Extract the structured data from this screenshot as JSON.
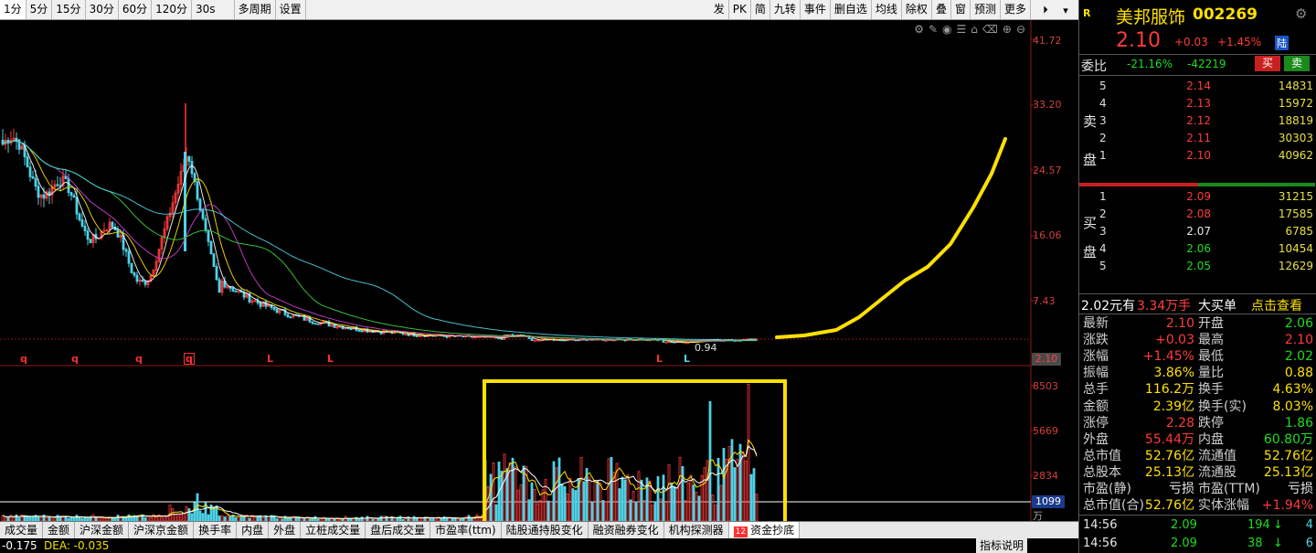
{
  "toolbar": {
    "periods": [
      "1分",
      "5分",
      "15分",
      "30分",
      "60分",
      "120分",
      "30s",
      "多周期",
      "设置"
    ],
    "actions": [
      "发",
      "PK",
      "简",
      "九转",
      "事件",
      "删自选",
      "均线",
      "除权",
      "叠",
      "窗",
      "预测",
      "更多"
    ],
    "icons": [
      "expand-icon",
      "chevron-down-icon"
    ]
  },
  "chart": {
    "price_ticks": [
      "41.72",
      "33.20",
      "24.57",
      "16.06",
      "7.43",
      "2.10"
    ],
    "volume_ticks": [
      "8503",
      "5669",
      "2834",
      "1099"
    ],
    "volume_unit": "万",
    "low_label": "0.94",
    "marks": [
      "q",
      "q",
      "q",
      "q",
      "L",
      "L",
      "L",
      "L"
    ],
    "tools": [
      "⚙",
      "✎",
      "◉",
      "☰",
      "⌂",
      "⌫",
      "⊕",
      "⊖"
    ]
  },
  "chart_data": {
    "type": "candlestick",
    "note_colors": {
      "up": "#ff3b3b",
      "down": "#4dd3e8",
      "ma": [
        "#ffffff",
        "#ffe000",
        "#d040d0",
        "#40d040",
        "#4dd3e8"
      ],
      "projection": "#ffe000",
      "highlight_box": "#ffe000"
    },
    "price_axis": [
      2.1,
      7.43,
      16.06,
      24.57,
      33.2,
      41.72
    ],
    "volume_axis": [
      1099,
      2834,
      5669,
      8503
    ],
    "current_price": 2.1,
    "period_low": 0.94
  },
  "bottom_tabs": [
    "成交量",
    "金额",
    "沪深金额",
    "沪深京金额",
    "换手率",
    "内盘",
    "外盘",
    "立桩成交量",
    "盘后成交量",
    "市盈率(ttm)",
    "陆股通持股变化",
    "融资融券变化",
    "机构探测器",
    "资金抄底"
  ],
  "bottom_tab_badge": "12",
  "status": {
    "s1": "-0.175",
    "s2": "DEA: -0.035",
    "help": "指标说明"
  },
  "panel": {
    "badge": "R",
    "name": "美邦服饰",
    "code": "002269",
    "price": "2.10",
    "change": "+0.03",
    "change_pct": "+1.45%",
    "tag": "陆",
    "weibi_label": "委比",
    "weibi_pct": "-21.16%",
    "weicha": "-42219",
    "buy_btn": "买",
    "sell_btn": "卖",
    "sell_label": "卖盘",
    "buy_label": "买盘",
    "asks": [
      {
        "lv": "5",
        "price": "2.14",
        "vol": "14831"
      },
      {
        "lv": "4",
        "price": "2.13",
        "vol": "15972"
      },
      {
        "lv": "3",
        "price": "2.12",
        "vol": "18819"
      },
      {
        "lv": "2",
        "price": "2.11",
        "vol": "30303"
      },
      {
        "lv": "1",
        "price": "2.10",
        "vol": "40962"
      }
    ],
    "bids": [
      {
        "lv": "1",
        "price": "2.09",
        "vol": "31215"
      },
      {
        "lv": "2",
        "price": "2.08",
        "vol": "17585"
      },
      {
        "lv": "3",
        "price": "2.07",
        "vol": "6785"
      },
      {
        "lv": "4",
        "price": "2.06",
        "vol": "10454"
      },
      {
        "lv": "5",
        "price": "2.05",
        "vol": "12629"
      }
    ],
    "bigorder": {
      "price": "2.02元有",
      "hands": "3.34万手",
      "label": "大买单",
      "link": "点击查看"
    },
    "stats": [
      {
        "k1": "最新",
        "v1": "2.10",
        "c1": "red",
        "k2": "开盘",
        "v2": "2.06",
        "c2": "green"
      },
      {
        "k1": "涨跌",
        "v1": "+0.03",
        "c1": "red",
        "k2": "最高",
        "v2": "2.10",
        "c2": "red"
      },
      {
        "k1": "涨幅",
        "v1": "+1.45%",
        "c1": "red",
        "k2": "最低",
        "v2": "2.02",
        "c2": "green"
      },
      {
        "k1": "振幅",
        "v1": "3.86%",
        "c1": "yellow",
        "k2": "量比",
        "v2": "0.88",
        "c2": "yellow"
      },
      {
        "k1": "总手",
        "v1": "116.2万",
        "c1": "yellow",
        "k2": "换手",
        "v2": "4.63%",
        "c2": "yellow"
      },
      {
        "k1": "金额",
        "v1": "2.39亿",
        "c1": "yellow",
        "k2": "换手(实)",
        "v2": "8.03%",
        "c2": "yellow"
      },
      {
        "k1": "涨停",
        "v1": "2.28",
        "c1": "red",
        "k2": "跌停",
        "v2": "1.86",
        "c2": "green"
      },
      {
        "k1": "外盘",
        "v1": "55.44万",
        "c1": "red",
        "k2": "内盘",
        "v2": "60.80万",
        "c2": "green"
      },
      {
        "k1": "总市值",
        "v1": "52.76亿",
        "c1": "yellow",
        "k2": "流通值",
        "v2": "52.76亿",
        "c2": "yellow"
      },
      {
        "k1": "总股本",
        "v1": "25.13亿",
        "c1": "yellow",
        "k2": "流通股",
        "v2": "25.13亿",
        "c2": "yellow"
      },
      {
        "k1": "市盈(静)",
        "v1": "亏损",
        "c1": "white",
        "k2": "市盈(TTM)",
        "v2": "亏损",
        "c2": "white"
      },
      {
        "k1": "总市值(合)",
        "v1": "52.76亿",
        "c1": "yellow",
        "k2": "实体涨幅",
        "v2": "+1.94%",
        "c2": "red"
      }
    ],
    "ticks": [
      {
        "time": "14:56",
        "price": "2.09",
        "vol": "194",
        "dir": "↓",
        "n": "4"
      },
      {
        "time": "14:56",
        "price": "2.09",
        "vol": "38",
        "dir": "↓",
        "n": "6"
      }
    ]
  }
}
